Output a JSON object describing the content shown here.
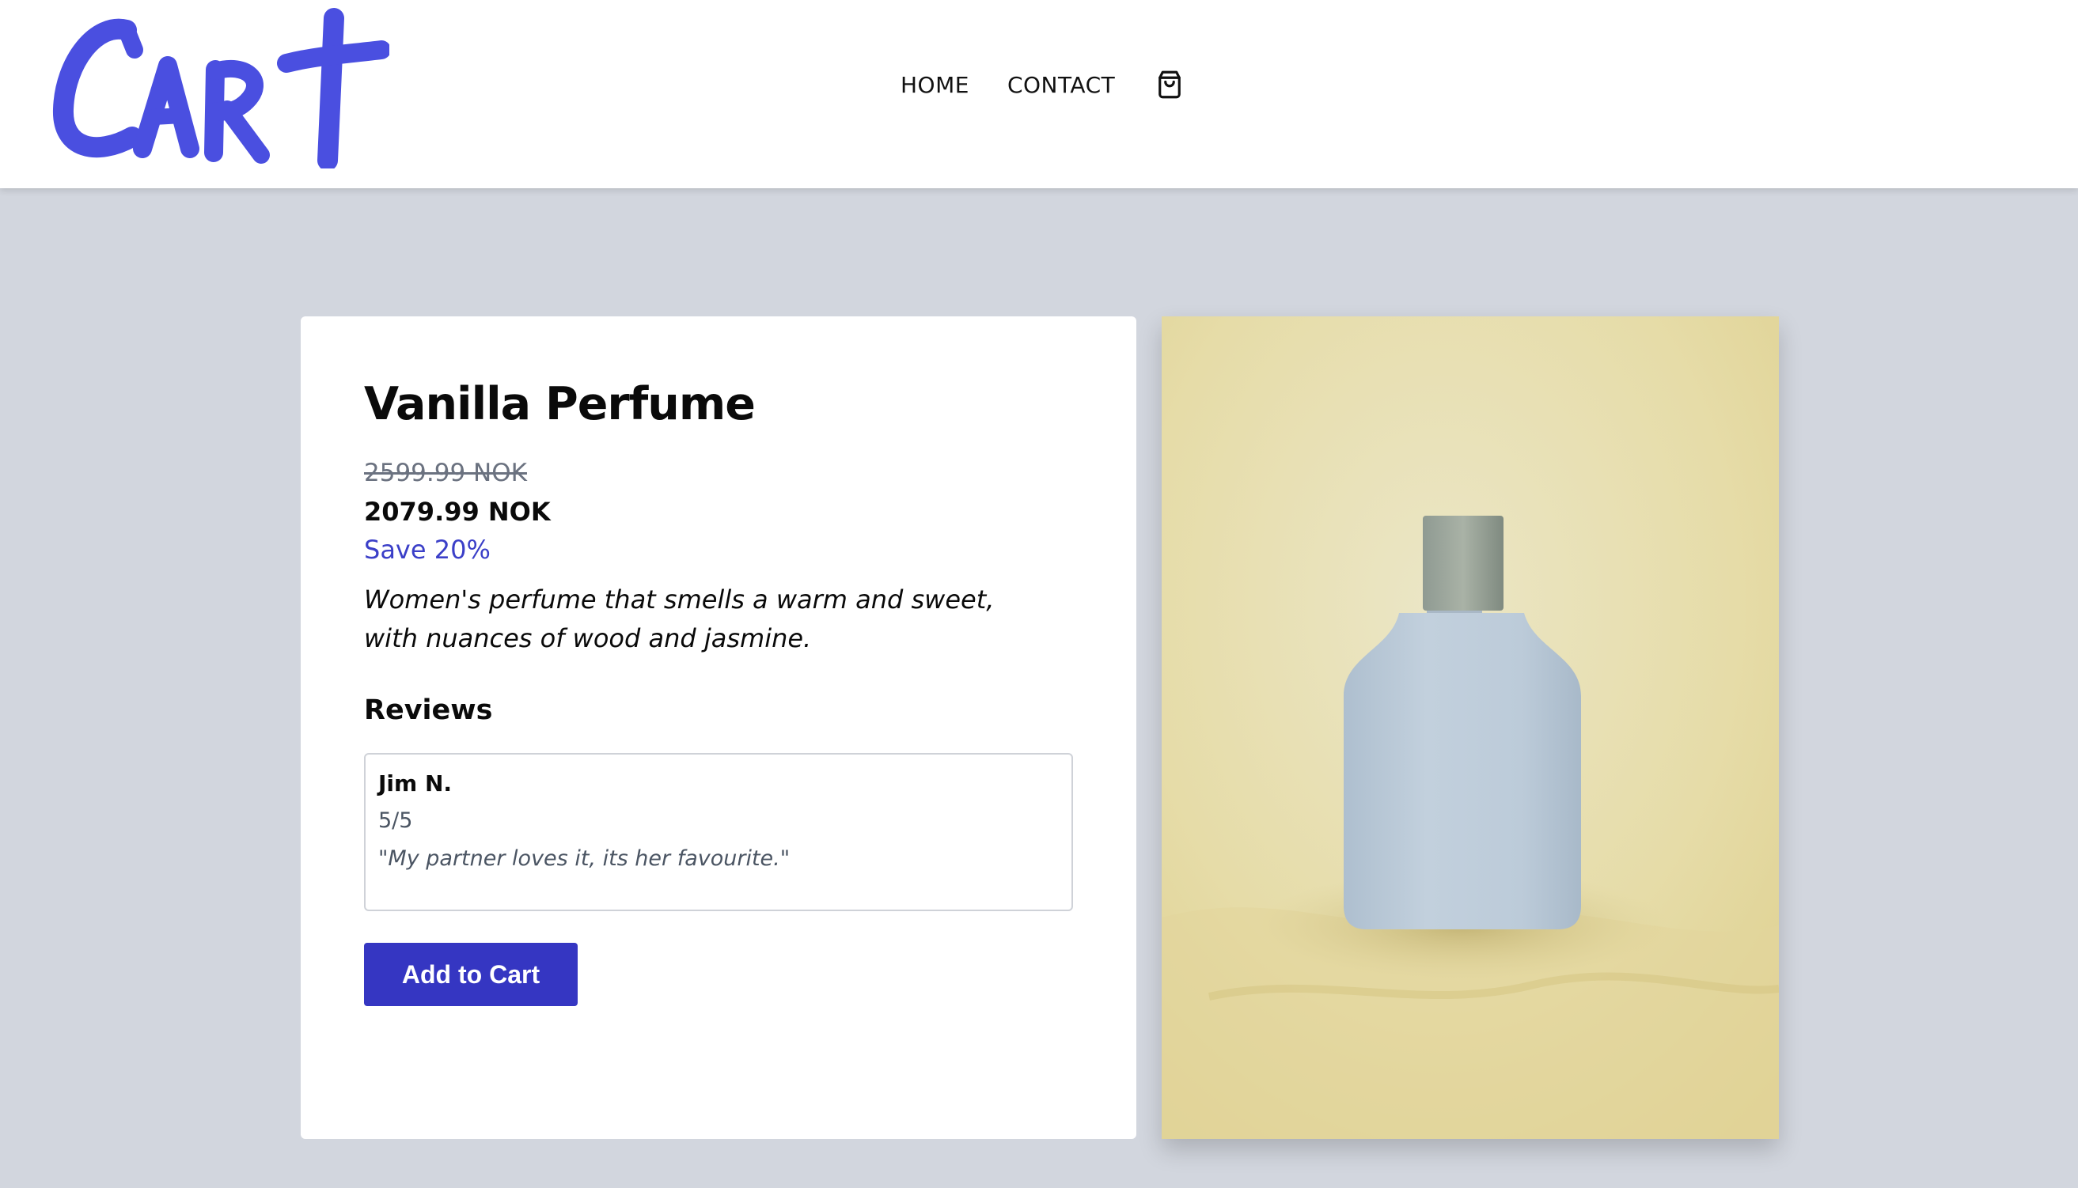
{
  "header": {
    "logo_text": "Cart",
    "brand_color": "#4a4fe0",
    "nav": {
      "home_label": "HOME",
      "contact_label": "CONTACT",
      "cart_icon": "shopping-bag-icon"
    }
  },
  "product": {
    "title": "Vanilla Perfume",
    "original_price": "2599.99 NOK",
    "discounted_price": "2079.99 NOK",
    "savings": "Save 20%",
    "description": "Women's perfume that smells a warm and sweet, with nuances of wood and jasmine.",
    "image_alt": "Perfume bottle",
    "reviews": {
      "heading": "Reviews",
      "items": [
        {
          "author": "Jim N.",
          "rating": "5/5",
          "text": "\"My partner loves it, its her favourite.\""
        }
      ]
    },
    "add_to_cart_label": "Add to Cart"
  },
  "colors": {
    "page_background": "#d2d6de",
    "accent": "#3536c2",
    "savings_text": "#3b3fc8",
    "image_background": "#ebe3b5"
  }
}
